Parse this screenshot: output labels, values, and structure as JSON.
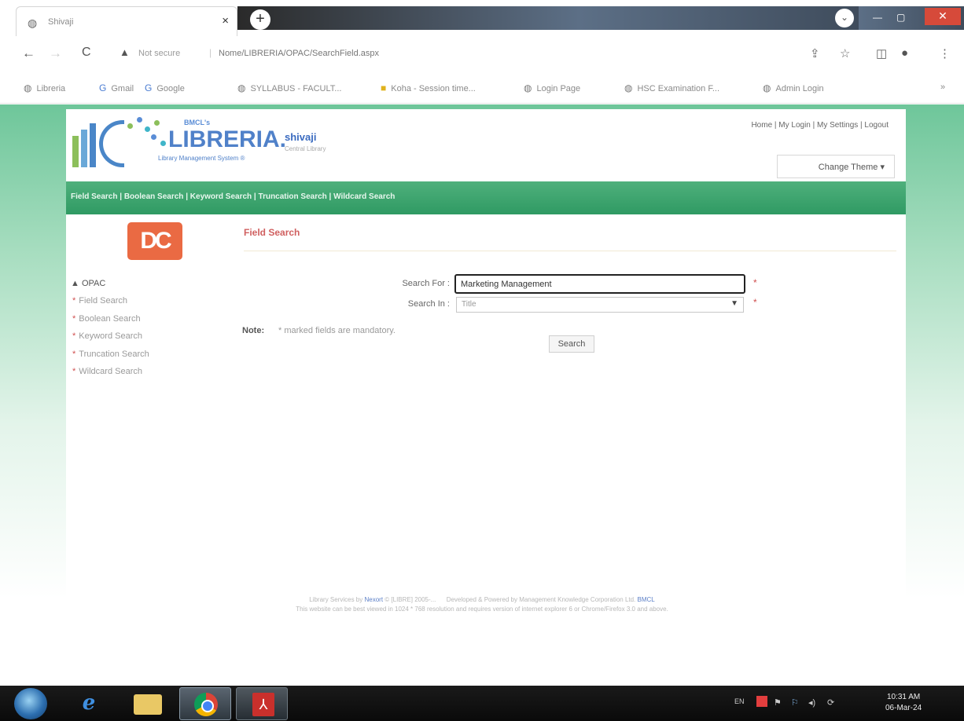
{
  "browser": {
    "tab_title": "Shivaji",
    "tab_close": "×",
    "new_tab": "+",
    "window_down": "⌄",
    "window_min": "—",
    "window_max": "▢",
    "window_close": "✕",
    "nav": {
      "back": "←",
      "forward": "→",
      "reload": "C"
    },
    "security_icon": "▲",
    "security_text": "Not secure",
    "url": "Nome/LIBRERIA/OPAC/SearchField.aspx",
    "right_icons": [
      "share-icon",
      "star-icon",
      "sidepanel-icon",
      "profile-icon",
      "menu-icon"
    ],
    "bookmarks": [
      {
        "icon": "globe-icon",
        "label": "Libreria"
      },
      {
        "icon": "google-icon",
        "label": "Gmail"
      },
      {
        "icon": "google-icon",
        "label": "Google"
      },
      {
        "icon": "globe-icon",
        "label": "SYLLABUS - FACULT..."
      },
      {
        "icon": "koha-icon",
        "label": "Koha - Session time..."
      },
      {
        "icon": "globe-icon",
        "label": "Login Page"
      },
      {
        "icon": "globe-icon",
        "label": "HSC Examination F..."
      },
      {
        "icon": "globe-icon",
        "label": "Admin Login"
      }
    ]
  },
  "header": {
    "brand_small": "BMCL's",
    "brand": "LIBRERIA.",
    "brand_sub": "Library Management System ®",
    "institution": "shivaji",
    "institution_sub": "Central Library",
    "top_links": "Home | My Login | My Settings | Logout",
    "change_theme": "Change Theme ▾"
  },
  "menu": [
    "Field Search",
    "Boolean Search",
    "Keyword Search",
    "Truncation Search",
    "Wildcard Search"
  ],
  "menu_sep": " | ",
  "sidebar": {
    "logo_text": "DC",
    "root": "OPAC",
    "root_toggle": "▲",
    "items": [
      "Field Search",
      "Boolean Search",
      "Keyword Search",
      "Truncation Search",
      "Wildcard Search"
    ]
  },
  "form": {
    "title": "Field Search",
    "search_for_label": "Search For :",
    "search_for_value": "Marketing Management",
    "search_in_label": "Search In :",
    "search_in_value": "Title",
    "required_mark": "*",
    "note_label": "Note:",
    "note_text": "* marked fields are mandatory.",
    "search_button": "Search"
  },
  "footer": {
    "line1_prefix": "Library Services by",
    "line1_link": "Nexort",
    "line1_mid": "© [LIBRE] 2005-...",
    "line1_dev": "Developed & Powered by Management Knowledge Corporation Ltd.",
    "line1_dev_link": "BMCL",
    "line2": "This website can be best viewed in 1024 * 768 resolution and requires version of internet explorer 6 or Chrome/Firefox 3.0 and above."
  },
  "taskbar": {
    "apps": [
      "windows-start-icon",
      "internet-explorer-icon",
      "file-explorer-icon",
      "chrome-icon",
      "pdf-reader-icon"
    ],
    "ie_glyph": "e",
    "lang": "EN",
    "tray_icons": [
      "flag-icon",
      "network-icon",
      "volume-icon",
      "sync-icon"
    ],
    "time": "10:31 AM",
    "date": "06-Mar-24"
  }
}
